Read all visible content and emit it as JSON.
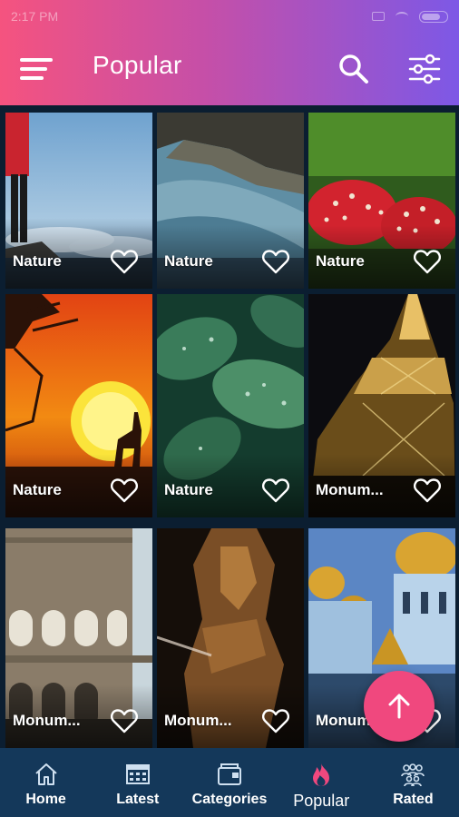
{
  "status_bar": {
    "time": "2:17 PM"
  },
  "header": {
    "title": "Popular"
  },
  "colors": {
    "accent": "#f0487e",
    "gradient_start": "#f5537f",
    "gradient_end": "#7d58e6",
    "nav_bg": "#14385a"
  },
  "tiles": [
    {
      "label": "Nature",
      "art": "cliff-person-clouds"
    },
    {
      "label": "Nature",
      "art": "coastline-aerial"
    },
    {
      "label": "Nature",
      "art": "red-mushrooms"
    },
    {
      "label": "Nature",
      "art": "savanna-sunset-giraffe"
    },
    {
      "label": "Nature",
      "art": "wet-green-leaves"
    },
    {
      "label": "Monum...",
      "art": "eiffel-tower-night"
    },
    {
      "label": "Monum...",
      "art": "colosseum"
    },
    {
      "label": "Monum...",
      "art": "bronze-statue"
    },
    {
      "label": "Monum...",
      "art": "golden-domes-cathedral"
    }
  ],
  "bottom_nav": [
    {
      "label": "Home",
      "icon": "home-icon"
    },
    {
      "label": "Latest",
      "icon": "latest-icon"
    },
    {
      "label": "Categories",
      "icon": "categories-icon"
    },
    {
      "label": "Popular",
      "icon": "flame-icon",
      "active": true
    },
    {
      "label": "Rated",
      "icon": "rated-icon"
    }
  ],
  "fab": {
    "icon": "arrow-up-icon"
  }
}
